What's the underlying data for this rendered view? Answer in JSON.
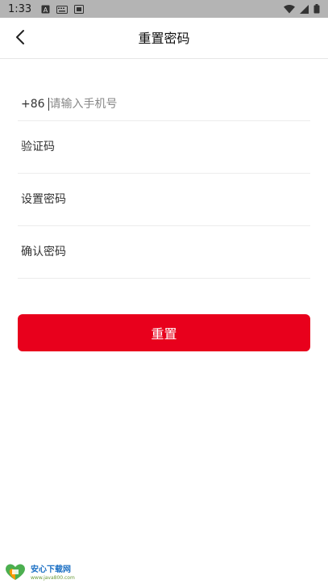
{
  "status_bar": {
    "time": "1:33",
    "left_icons": [
      "a-letter-icon",
      "keyboard-icon",
      "sim-card-icon"
    ],
    "right_icons": [
      "wifi-icon",
      "signal-icon",
      "battery-icon"
    ]
  },
  "header": {
    "title": "重置密码",
    "back_icon": "chevron-left-icon"
  },
  "form": {
    "phone": {
      "country_code": "+86",
      "placeholder": "请输入手机号",
      "value": ""
    },
    "verification_code": {
      "placeholder": "验证码",
      "value": ""
    },
    "set_password": {
      "placeholder": "设置密码",
      "value": ""
    },
    "confirm_password": {
      "placeholder": "确认密码",
      "value": ""
    }
  },
  "actions": {
    "reset_label": "重置"
  },
  "watermark": {
    "title": "安心下载网",
    "subtitle": "www.java800.com"
  },
  "colors": {
    "accent": "#e8001c",
    "status_bar": "#b4b4b4",
    "divider": "#ececec"
  }
}
